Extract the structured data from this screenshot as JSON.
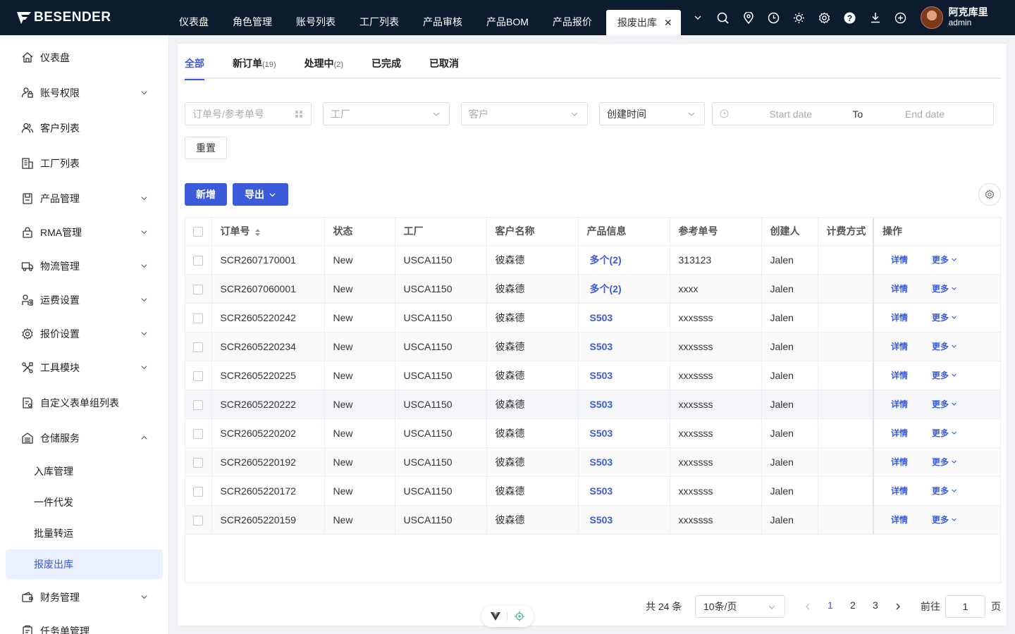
{
  "brand": {
    "name": "BESENDER"
  },
  "topnav": {
    "items": [
      "仪表盘",
      "角色管理",
      "账号列表",
      "工厂列表",
      "产品审核",
      "产品BOM",
      "产品报价"
    ],
    "active_tab": "报废出库",
    "close_glyph": "✕"
  },
  "user": {
    "name": "阿克库里",
    "role": "admin"
  },
  "sidebar": {
    "items": [
      {
        "label": "仪表盘",
        "icon": "home-icon",
        "expandable": false
      },
      {
        "label": "账号权限",
        "icon": "user-lock-icon",
        "expandable": true
      },
      {
        "label": "客户列表",
        "icon": "users-icon",
        "expandable": false
      },
      {
        "label": "工厂列表",
        "icon": "building-icon",
        "expandable": false
      },
      {
        "label": "产品管理",
        "icon": "product-icon",
        "expandable": true
      },
      {
        "label": "RMA管理",
        "icon": "rma-icon",
        "expandable": true
      },
      {
        "label": "物流管理",
        "icon": "truck-icon",
        "expandable": true
      },
      {
        "label": "运费设置",
        "icon": "freight-icon",
        "expandable": true
      },
      {
        "label": "报价设置",
        "icon": "gear-icon",
        "expandable": true
      },
      {
        "label": "工具模块",
        "icon": "tools-icon",
        "expandable": true
      },
      {
        "label": "自定义表单组列表",
        "icon": "form-icon",
        "expandable": false
      },
      {
        "label": "仓储服务",
        "icon": "warehouse-icon",
        "expandable": true,
        "expanded": true
      }
    ],
    "subitems": [
      "入库管理",
      "一件代发",
      "批量转运",
      "报废出库"
    ],
    "active_subitem": "报废出库",
    "after_items": [
      {
        "label": "财务管理",
        "icon": "finance-icon",
        "expandable": true
      },
      {
        "label": "任务单管理",
        "icon": "task-icon",
        "expandable": false
      }
    ]
  },
  "tabs": [
    {
      "label": "全部",
      "count": ""
    },
    {
      "label": "新订单",
      "count": "(19)"
    },
    {
      "label": "处理中",
      "count": "(2)"
    },
    {
      "label": "已完成",
      "count": ""
    },
    {
      "label": "已取消",
      "count": ""
    }
  ],
  "filters": {
    "order_placeholder": "订单号/参考单号",
    "factory_placeholder": "工厂",
    "customer_placeholder": "客户",
    "time_type": "创建时间",
    "start_placeholder": "Start date",
    "range_sep": "To",
    "end_placeholder": "End date",
    "reset_label": "重置"
  },
  "actions": {
    "new_label": "新增",
    "export_label": "导出"
  },
  "table": {
    "columns": [
      "订单号",
      "状态",
      "工厂",
      "客户名称",
      "产品信息",
      "参考单号",
      "创建人",
      "计费方式",
      "操作"
    ],
    "rows": [
      {
        "order": "SCR2607170001",
        "status": "New",
        "factory": "USCA1150",
        "customer": "彼森德",
        "product": "多个(2)",
        "ref": "313123",
        "creator": "Jalen",
        "billing": ""
      },
      {
        "order": "SCR2607060001",
        "status": "New",
        "factory": "USCA1150",
        "customer": "彼森德",
        "product": "多个(2)",
        "ref": "xxxx",
        "creator": "Jalen",
        "billing": ""
      },
      {
        "order": "SCR2605220242",
        "status": "New",
        "factory": "USCA1150",
        "customer": "彼森德",
        "product": "S503",
        "ref": "xxxssss",
        "creator": "Jalen",
        "billing": ""
      },
      {
        "order": "SCR2605220234",
        "status": "New",
        "factory": "USCA1150",
        "customer": "彼森德",
        "product": "S503",
        "ref": "xxxssss",
        "creator": "Jalen",
        "billing": ""
      },
      {
        "order": "SCR2605220225",
        "status": "New",
        "factory": "USCA1150",
        "customer": "彼森德",
        "product": "S503",
        "ref": "xxxssss",
        "creator": "Jalen",
        "billing": ""
      },
      {
        "order": "SCR2605220222",
        "status": "New",
        "factory": "USCA1150",
        "customer": "彼森德",
        "product": "S503",
        "ref": "xxxssss",
        "creator": "Jalen",
        "billing": ""
      },
      {
        "order": "SCR2605220202",
        "status": "New",
        "factory": "USCA1150",
        "customer": "彼森德",
        "product": "S503",
        "ref": "xxxssss",
        "creator": "Jalen",
        "billing": ""
      },
      {
        "order": "SCR2605220192",
        "status": "New",
        "factory": "USCA1150",
        "customer": "彼森德",
        "product": "S503",
        "ref": "xxxssss",
        "creator": "Jalen",
        "billing": ""
      },
      {
        "order": "SCR2605220172",
        "status": "New",
        "factory": "USCA1150",
        "customer": "彼森德",
        "product": "S503",
        "ref": "xxxssss",
        "creator": "Jalen",
        "billing": ""
      },
      {
        "order": "SCR2605220159",
        "status": "New",
        "factory": "USCA1150",
        "customer": "彼森德",
        "product": "S503",
        "ref": "xxxssss",
        "creator": "Jalen",
        "billing": ""
      }
    ],
    "op_detail": "详情",
    "op_more": "更多"
  },
  "pagination": {
    "total": "共 24 条",
    "page_size": "10条/页",
    "pages": [
      "1",
      "2",
      "3"
    ],
    "current_page": "1",
    "goto_label": "前往",
    "goto_value": "1",
    "goto_unit": "页"
  },
  "colors": {
    "primary": "#3b5bdb",
    "topbar": "#0d1b2e",
    "active_bg": "#eaf0ff"
  }
}
